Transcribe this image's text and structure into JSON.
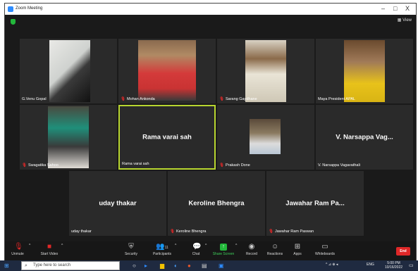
{
  "window": {
    "title": "Zoom Meeting",
    "minimize": "–",
    "maximize": "□",
    "close": "X"
  },
  "view_label": "View",
  "participants": [
    {
      "name": "G.Venu Gopal",
      "muted": false
    },
    {
      "name": "Mohan Ankonda",
      "muted": true
    },
    {
      "name": "Sarang Gaydhane",
      "muted": true
    },
    {
      "name": "Maya President APAL",
      "muted": false
    },
    {
      "name": "Swagatika Sahoo",
      "muted": true
    },
    {
      "name": "Rama varai sah",
      "display": "Rama varai sah",
      "muted": false,
      "active": true
    },
    {
      "name": "Prakash Done",
      "muted": true
    },
    {
      "name": "V. Narsappa Vagavathali",
      "display": "V. Narsappa Vag...",
      "muted": false
    },
    {
      "name": "uday thakar",
      "display": "uday thakar",
      "muted": false
    },
    {
      "name": "Keroline Bhengra",
      "display": "Keroline Bhengra",
      "muted": true
    },
    {
      "name": "Jawahar Ram Paswan",
      "display": "Jawahar Ram Pa...",
      "muted": true
    }
  ],
  "toolbar": {
    "unmute": "Unmute",
    "start_video": "Start Video",
    "security": "Security",
    "participants": "Participants",
    "participants_count": "11",
    "chat": "Chat",
    "share_screen": "Share Screen",
    "record": "Record",
    "reactions": "Reactions",
    "apps": "Apps",
    "whiteboards": "Whiteboards",
    "end": "End"
  },
  "taskbar": {
    "search_placeholder": "Type here to search",
    "language": "ENG",
    "time": "5:00 PM",
    "date": "10/16/2022"
  },
  "colors": {
    "active_border": "#b8d62f",
    "mute_red": "#e02828",
    "share_green": "#23b83b",
    "end_red": "#e02828"
  }
}
